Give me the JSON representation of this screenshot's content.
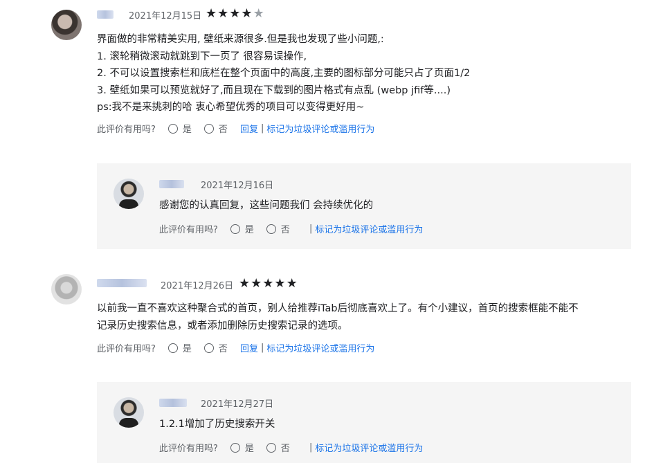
{
  "reviews": [
    {
      "date": "2021年12月15日",
      "stars": [
        "★",
        "★",
        "★",
        "★",
        "★"
      ],
      "rating": 4,
      "text": "界面做的非常精美实用, 壁纸来源很多.但是我也发现了些小问题,:\n1. 滚轮稍微滚动就跳到下一页了 很容易误操作,\n2. 不可以设置搜索栏和底栏在整个页面中的高度,主要的图标部分可能只占了页面1/2\n3. 壁纸如果可以预览就好了,而且现在下载到的图片格式有点乱 (webp jfif等....)\nps:我不是来挑刺的哈 衷心希望优秀的项目可以变得更好用~",
      "helpful_label": "此评价有用吗?",
      "yes": "是",
      "no": "否",
      "reply_link": "回复",
      "sep": "|",
      "report_link": "标记为垃圾评论或滥用行为",
      "dev_reply": {
        "date": "2021年12月16日",
        "text": "感谢您的认真回复，这些问题我们 会持续优化的",
        "helpful_label": "此评价有用吗?",
        "yes": "是",
        "no": "否",
        "sep": "|",
        "report_link": "标记为垃圾评论或滥用行为"
      }
    },
    {
      "date": "2021年12月26日",
      "stars": [
        "★",
        "★",
        "★",
        "★",
        "★"
      ],
      "rating": 5,
      "text": "以前我一直不喜欢这种聚合式的首页，别人给推荐iTab后彻底喜欢上了。有个小建议，首页的搜索框能不能不\n记录历史搜索信息，或者添加删除历史搜索记录的选项。",
      "helpful_label": "此评价有用吗?",
      "yes": "是",
      "no": "否",
      "reply_link": "回复",
      "sep": "|",
      "report_link": "标记为垃圾评论或滥用行为",
      "dev_reply": {
        "date": "2021年12月27日",
        "text": "1.2.1增加了历史搜索开关",
        "helpful_label": "此评价有用吗?",
        "yes": "是",
        "no": "否",
        "sep": "|",
        "report_link": "标记为垃圾评论或滥用行为"
      }
    }
  ]
}
